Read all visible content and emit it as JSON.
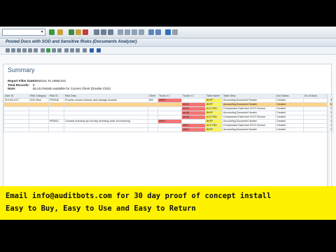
{
  "window": {
    "title": "Posted Docs with SOD and Sensitive Risks (Documents Analyzer)"
  },
  "summary": {
    "heading": "Summary",
    "report_filter_label": "Report Filter Date :",
    "report_filter_value": "19950101 To 19951231",
    "total_records_label": "Total Records:",
    "total_records_value": "8",
    "note_label": "Note:",
    "note_value": "BLUU Details available for Current Client (Double Click)"
  },
  "table": {
    "headers": [
      "User ID",
      "Risk Category",
      "Risk ID",
      "Risk Desc",
      "Client",
      "Tcode # 1",
      "Tcode # 2",
      "Table Name",
      "Table Desc",
      "Doc Status",
      "No of Docs"
    ],
    "rows": [
      [
        "SCHOLZ/CT",
        "SOD Risk",
        "PR0046",
        "Process vendor invoices and manage services",
        "800",
        "MIRO",
        "",
        "BKPF",
        "Accounting Document Header",
        "Created",
        "9"
      ],
      [
        "",
        "",
        "",
        "",
        "",
        "",
        "ML81",
        "BKPF",
        "Accounting Document Header",
        "Created",
        "9"
      ],
      [
        "",
        "",
        "",
        "",
        "",
        "",
        "ML81",
        "ACCTHD",
        "Compressed Data from FI/CO Docum",
        "Created",
        "1"
      ],
      [
        "",
        "",
        "",
        "",
        "",
        "",
        "ML85",
        "BKPF",
        "Accounting Document Header",
        "Created",
        "1"
      ],
      [
        "",
        "",
        "",
        "",
        "",
        "",
        "ML85",
        "ACCTHD",
        "Compressed Data from FI/CO Docum",
        "Created",
        "1"
      ],
      [
        "",
        "",
        "PR0001",
        "Conceal inventory by not fully receiving order but invoicing",
        "",
        "MIRO",
        "",
        "BKPF",
        "Accounting Document Header",
        "Created",
        "4"
      ],
      [
        "",
        "",
        "",
        "",
        "",
        "",
        "MB01",
        "ACCTHD",
        "Compressed Data from FI/CO Docum",
        "Created",
        "1"
      ],
      [
        "",
        "",
        "",
        "",
        "",
        "",
        "MB01",
        "BKPF",
        "Accounting Document Header",
        "Created",
        "1"
      ]
    ]
  },
  "banner": {
    "line1": "Email info@auditbots.com for 30 day proof of concept install",
    "line2": "Easy to Buy, Easy to Use and Easy to Return"
  },
  "colors": {
    "sod_red": "#f37474",
    "tcode_yellow": "#f9f45a",
    "selected_row": "#fcd38a",
    "banner_yellow": "#fff200"
  }
}
